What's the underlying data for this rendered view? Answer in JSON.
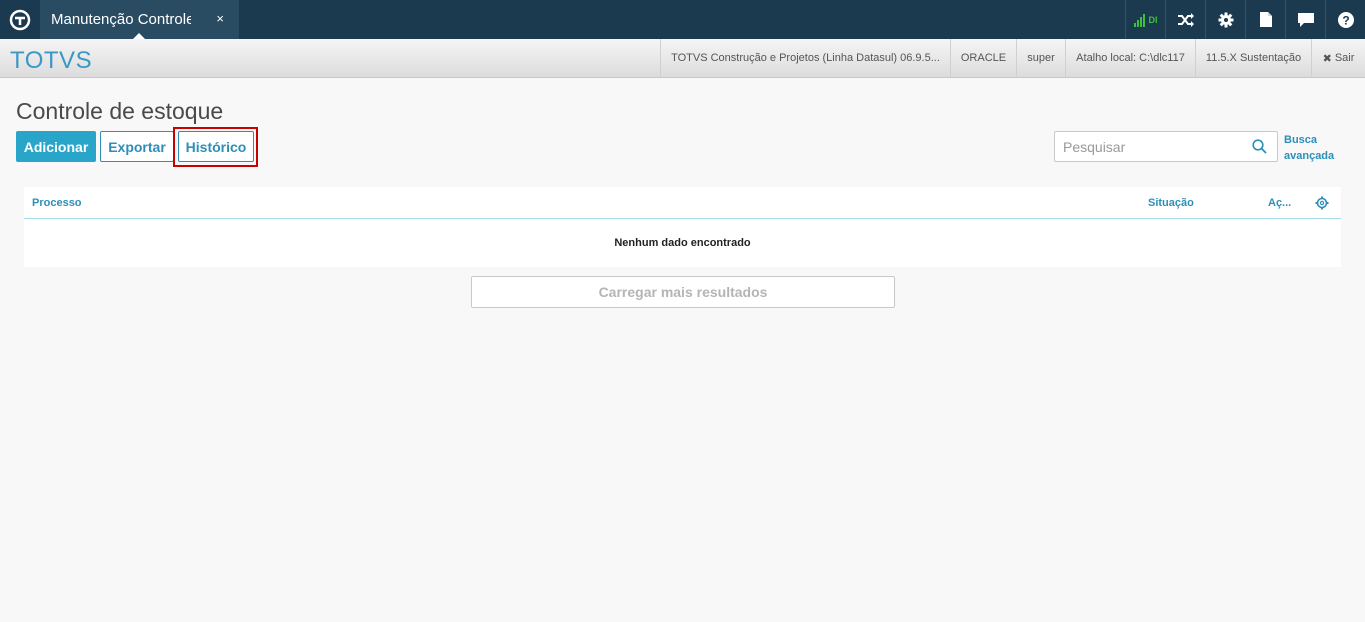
{
  "topbar": {
    "tab_label": "Manutenção Controle de Estoque",
    "tab_close": "×",
    "signal_label": "DI",
    "icons": [
      "logo-icon",
      "signal-icon",
      "shuffle-icon",
      "gear-icon",
      "document-icon",
      "chat-icon",
      "help-icon"
    ]
  },
  "header": {
    "brand": "TOTVS",
    "product": "TOTVS Construção e Projetos (Linha Datasul) 06.9.5...",
    "database": "ORACLE",
    "user": "super",
    "shortcut": "Atalho local: C:\\dlc117",
    "version": "11.5.X Sustentação",
    "logout": "Sair"
  },
  "page": {
    "title": "Controle de estoque",
    "add_label": "Adicionar",
    "export_label": "Exportar",
    "history_label": "Histórico",
    "search_placeholder": "Pesquisar",
    "advanced_search_line1": "Busca",
    "advanced_search_line2": "avançada"
  },
  "table": {
    "columns": [
      "Processo",
      "Situação",
      "Aç..."
    ],
    "empty_message": "Nenhum dado encontrado",
    "load_more": "Carregar mais resultados"
  },
  "colors": {
    "topbar": "#1b3a4f",
    "primary": "#29a5c9",
    "link": "#2c8fb8",
    "highlight": "#c90000"
  }
}
